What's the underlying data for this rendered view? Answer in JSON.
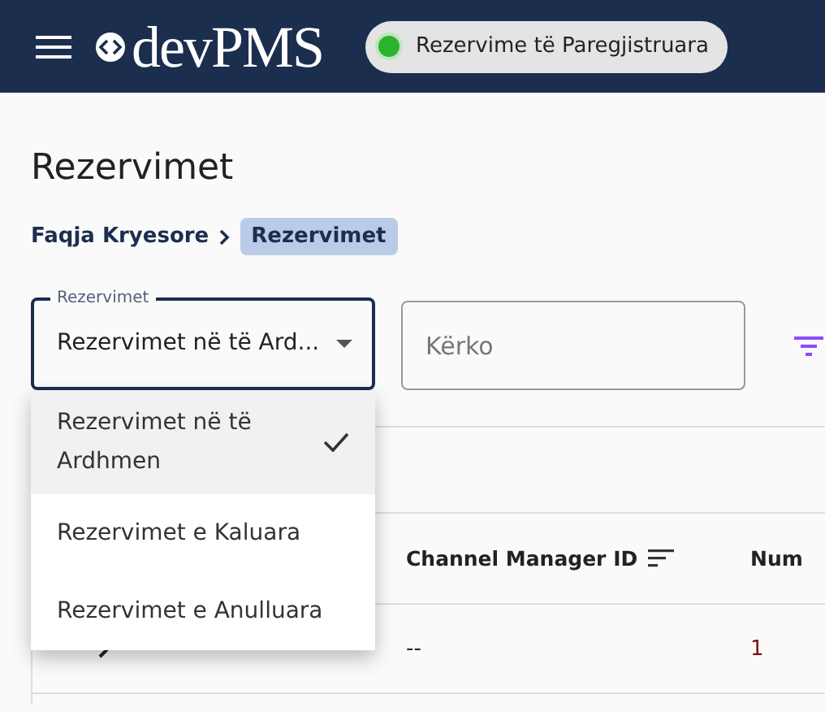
{
  "app_bar": {
    "logo": "devPMS",
    "status_chip": {
      "label": "Rezervime të Paregjistruara",
      "online": true
    }
  },
  "page": {
    "title": "Rezervimet",
    "breadcrumb": [
      {
        "label": "Faqja Kryesore",
        "current": false
      },
      {
        "label": "Rezervimet",
        "current": true
      }
    ]
  },
  "filters": {
    "select": {
      "label": "Rezervimet",
      "value": "Rezervimet në të Ard...",
      "expanded": true
    },
    "search": {
      "placeholder": "Kërko"
    }
  },
  "menu": [
    {
      "label": "Rezervimet në të Ardhmen",
      "selected": true
    },
    {
      "label": "Rezervimet e Kaluara",
      "selected": false
    },
    {
      "label": "Rezervimet e Anulluara",
      "selected": false
    }
  ],
  "table": {
    "columns": [
      {
        "label": "Channel Manager ID",
        "sortable": true
      },
      {
        "label": "Num",
        "sortable": false
      }
    ],
    "rows": [
      {
        "cells": [
          "--",
          "1"
        ]
      }
    ]
  }
}
